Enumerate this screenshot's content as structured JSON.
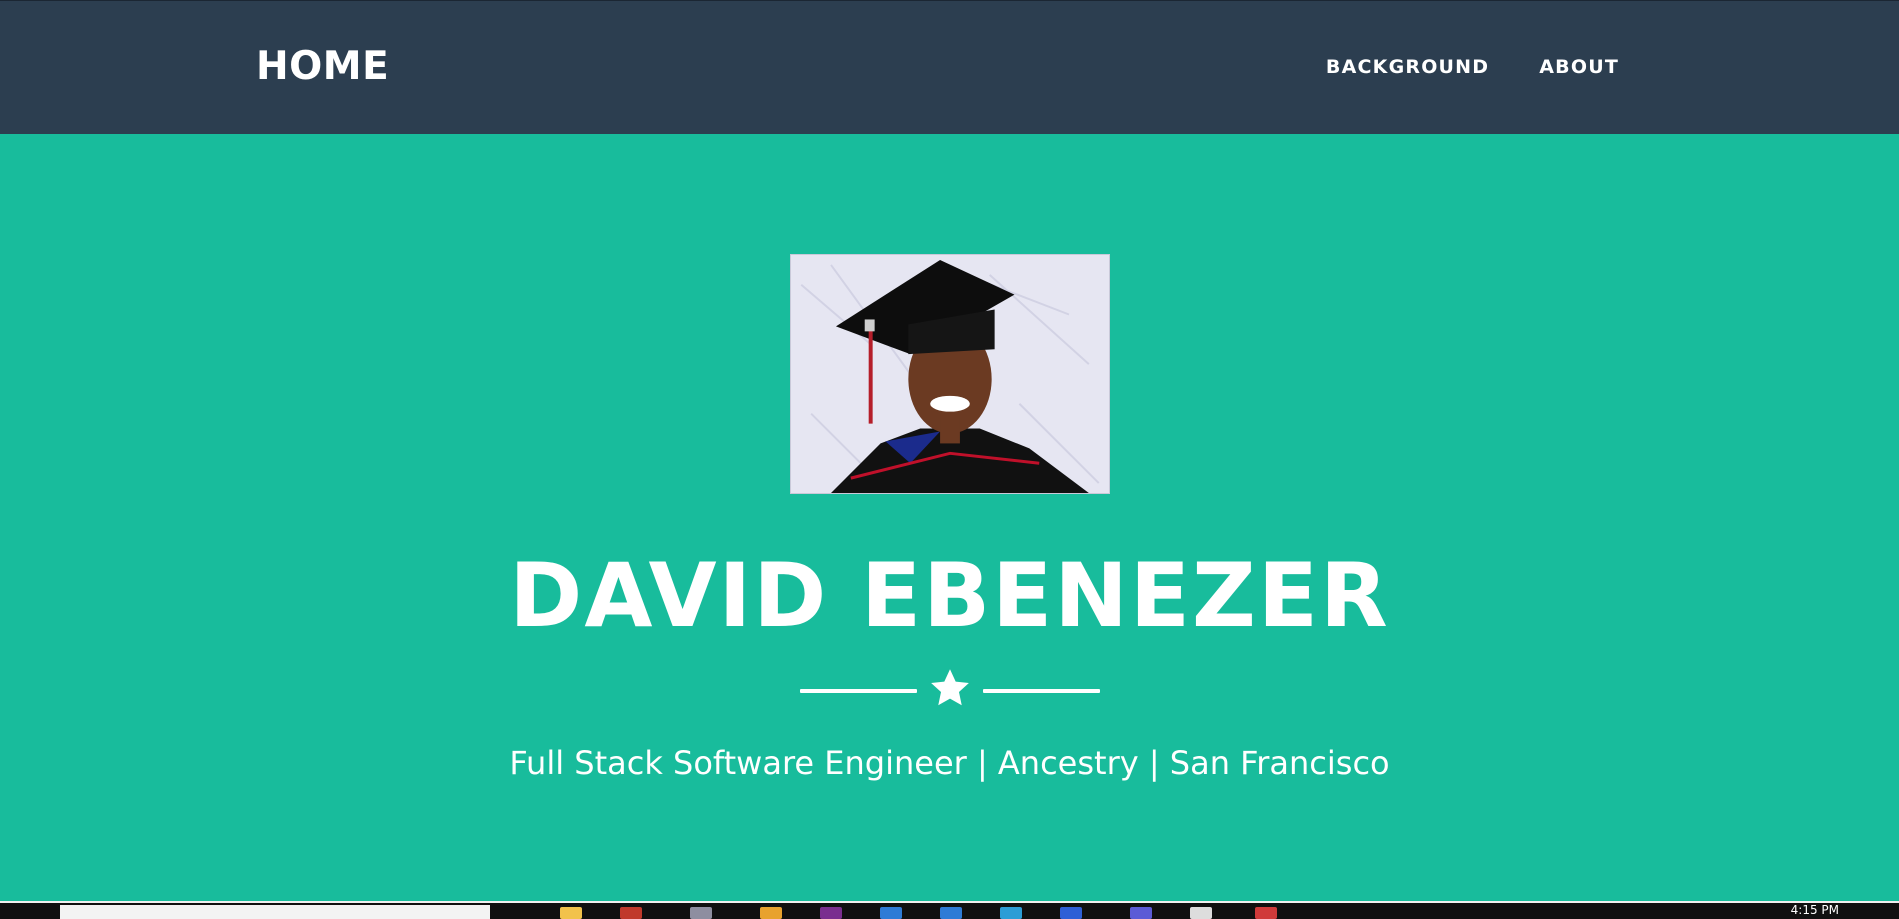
{
  "nav": {
    "brand": "HOME",
    "links": [
      "BACKGROUND",
      "ABOUT"
    ]
  },
  "hero": {
    "profile_image_alt": "graduation-portrait",
    "name": "DAVID EBENEZER",
    "divider_icon": "star-icon",
    "tagline": "Full Stack Software Engineer | Ancestry | San Francisco"
  },
  "taskbar": {
    "time": "4:15 PM"
  },
  "colors": {
    "navbar": "#2c3e50",
    "hero": "#18bc9c",
    "text": "#ffffff"
  }
}
